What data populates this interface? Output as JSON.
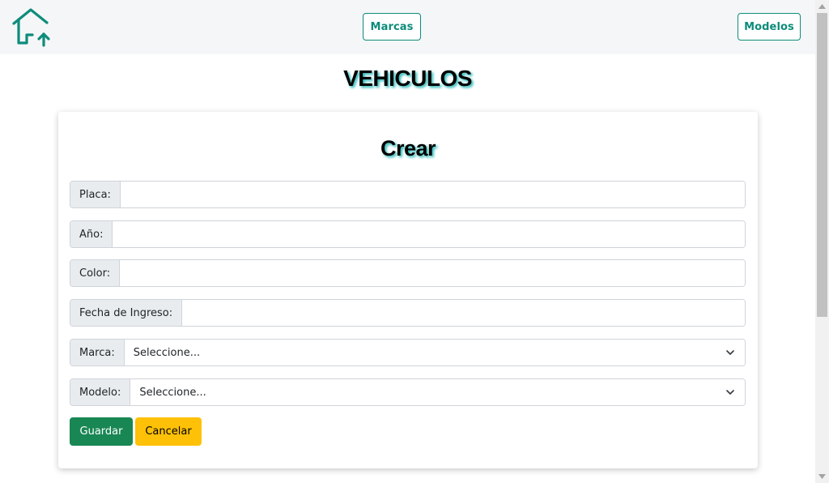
{
  "navbar": {
    "home_icon": "house-up-arrow-icon",
    "links": {
      "marcas": "Marcas",
      "modelos": "Modelos"
    }
  },
  "page": {
    "title": "VEHICULOS"
  },
  "form": {
    "title": "Crear",
    "fields": {
      "placa": {
        "label": "Placa:",
        "value": ""
      },
      "anio": {
        "label": "Año:",
        "value": ""
      },
      "color": {
        "label": "Color:",
        "value": ""
      },
      "fecha": {
        "label": "Fecha de Ingreso:",
        "value": ""
      }
    },
    "selects": {
      "marca": {
        "label": "Marca:",
        "selected": "Seleccione..."
      },
      "modelo": {
        "label": "Modelo:",
        "selected": "Seleccione..."
      }
    },
    "buttons": {
      "save": "Guardar",
      "cancel": "Cancelar"
    }
  },
  "colors": {
    "accent": "#0d8c7a",
    "title_shadow": "#19b3b3",
    "save": "#198754",
    "cancel": "#ffc107"
  }
}
